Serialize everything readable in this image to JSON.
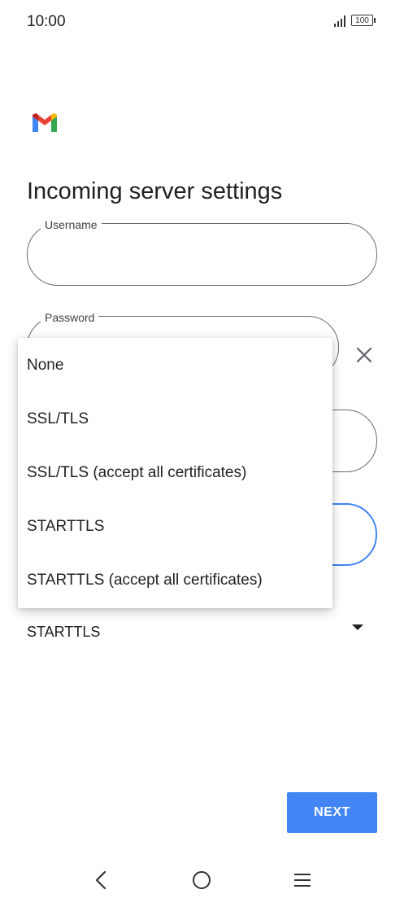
{
  "status_bar": {
    "time": "10:00",
    "battery": "100"
  },
  "page": {
    "title": "Incoming server settings"
  },
  "form": {
    "username": {
      "label": "Username",
      "value": ""
    },
    "password": {
      "label": "Password",
      "value": ""
    },
    "security": {
      "selected": "STARTTLS"
    }
  },
  "dropdown": {
    "options": [
      "None",
      "SSL/TLS",
      "SSL/TLS (accept all certificates)",
      "STARTTLS",
      "STARTTLS (accept all certificates)"
    ]
  },
  "actions": {
    "next_label": "NEXT"
  },
  "colors": {
    "accent": "#4285f4",
    "text": "#202124",
    "outline": "#6b6b6b"
  },
  "icons": {
    "logo": "gmail-logo",
    "clear": "close-icon",
    "nav_back": "back-icon",
    "nav_home": "home-icon",
    "nav_menu": "menu-icon"
  }
}
